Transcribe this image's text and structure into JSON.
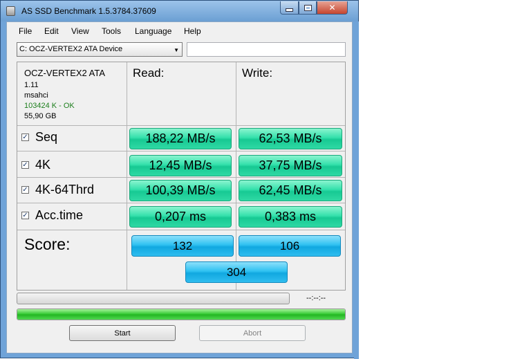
{
  "window": {
    "title": "AS SSD Benchmark 1.5.3784.37609",
    "controls": {
      "minimize": "minimize",
      "maximize": "maximize",
      "close": "✕"
    }
  },
  "menu": [
    "File",
    "Edit",
    "View",
    "Tools",
    "Language",
    "Help"
  ],
  "drive": {
    "selected": "C: OCZ-VERTEX2 ATA Device",
    "info_value": ""
  },
  "device_info": {
    "name": "OCZ-VERTEX2 ATA",
    "firmware": "1.11",
    "driver": "msahci",
    "alignment": "103424 K - OK",
    "size": "55,90 GB"
  },
  "columns": {
    "read": "Read:",
    "write": "Write:"
  },
  "tests": [
    {
      "label": "Seq",
      "checked": true,
      "read": "188,22 MB/s",
      "write": "62,53 MB/s"
    },
    {
      "label": "4K",
      "checked": true,
      "read": "12,45 MB/s",
      "write": "37,75 MB/s"
    },
    {
      "label": "4K-64Thrd",
      "checked": true,
      "read": "100,39 MB/s",
      "write": "62,45 MB/s"
    },
    {
      "label": "Acc.time",
      "checked": true,
      "read": "0,207 ms",
      "write": "0,383 ms"
    }
  ],
  "score": {
    "label": "Score:",
    "read": "132",
    "write": "106",
    "total": "304"
  },
  "progress": {
    "time_text": "--:--:--",
    "overall_fraction": 1.0
  },
  "buttons": {
    "start": "Start",
    "abort": "Abort"
  },
  "colors": {
    "result_green": "#2fd9a4",
    "score_blue": "#2fbdef",
    "progress_green": "#2ec82e"
  }
}
